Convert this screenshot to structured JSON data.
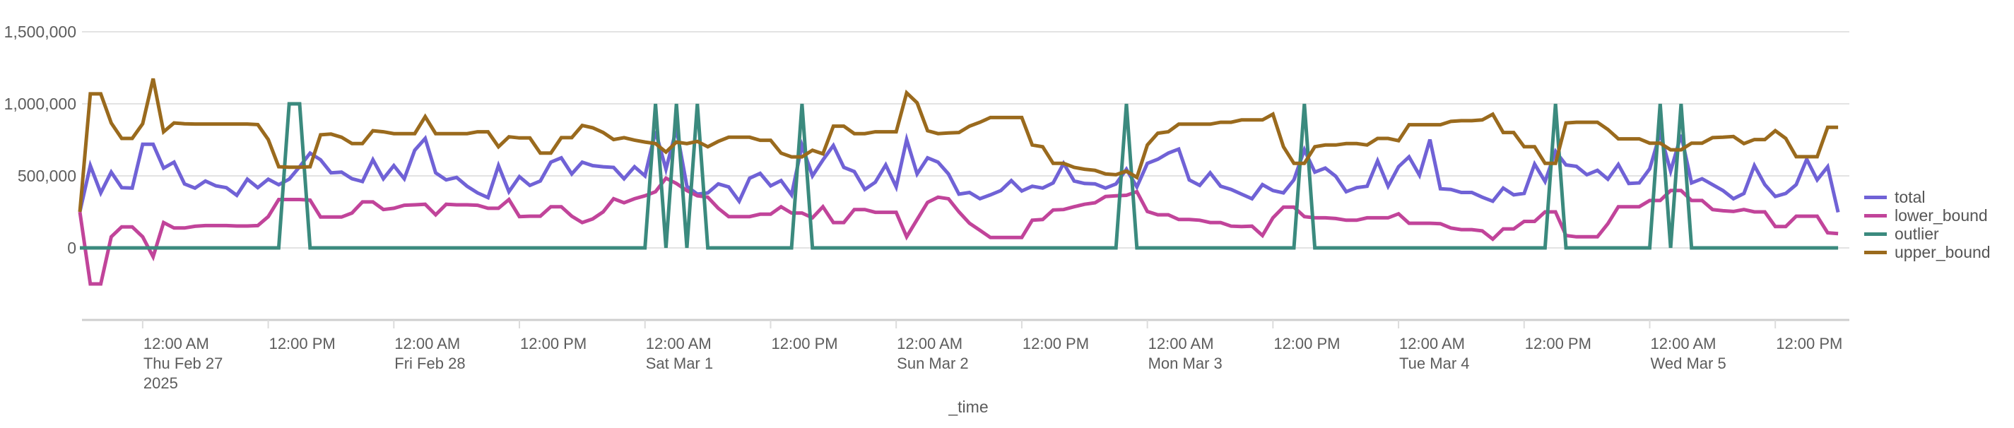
{
  "chart_data": {
    "type": "line",
    "title": "",
    "xlabel": "_time",
    "ylabel": "",
    "ylim": [
      -500000,
      1500000
    ],
    "yticks": [
      0,
      500000,
      1000000,
      1500000
    ],
    "ytick_labels": [
      "0",
      "500,000",
      "1,000,000",
      "1,500,000"
    ],
    "grid": true,
    "legend_position": "right",
    "x_start": "2025-02-26T18:00",
    "x_step_hours": 1,
    "x_axis_end_hours": 169,
    "xticks": [
      {
        "hours": 6,
        "lines": [
          "12:00 AM",
          "Thu Feb 27",
          "2025"
        ]
      },
      {
        "hours": 18,
        "lines": [
          "12:00 PM"
        ]
      },
      {
        "hours": 30,
        "lines": [
          "12:00 AM",
          "Fri Feb 28"
        ]
      },
      {
        "hours": 42,
        "lines": [
          "12:00 PM"
        ]
      },
      {
        "hours": 54,
        "lines": [
          "12:00 AM",
          "Sat Mar 1"
        ]
      },
      {
        "hours": 66,
        "lines": [
          "12:00 PM"
        ]
      },
      {
        "hours": 78,
        "lines": [
          "12:00 AM",
          "Sun Mar 2"
        ]
      },
      {
        "hours": 90,
        "lines": [
          "12:00 PM"
        ]
      },
      {
        "hours": 102,
        "lines": [
          "12:00 AM",
          "Mon Mar 3"
        ]
      },
      {
        "hours": 114,
        "lines": [
          "12:00 PM"
        ]
      },
      {
        "hours": 126,
        "lines": [
          "12:00 AM",
          "Tue Mar 4"
        ]
      },
      {
        "hours": 138,
        "lines": [
          "12:00 PM"
        ]
      },
      {
        "hours": 150,
        "lines": [
          "12:00 AM",
          "Wed Mar 5"
        ]
      },
      {
        "hours": 162,
        "lines": [
          "12:00 PM"
        ]
      }
    ],
    "series": [
      {
        "name": "total",
        "color": "#7062d6",
        "values": [
          250000,
          571000,
          382000,
          526000,
          418000,
          415000,
          719000,
          719000,
          554000,
          595000,
          444000,
          415000,
          464000,
          431000,
          418000,
          365000,
          477000,
          418000,
          477000,
          438000,
          477000,
          563000,
          658000,
          612000,
          521000,
          526000,
          480000,
          461000,
          612000,
          480000,
          571000,
          480000,
          678000,
          760000,
          521000,
          472000,
          489000,
          428000,
          382000,
          349000,
          571000,
          390000,
          494000,
          434000,
          464000,
          595000,
          625000,
          513000,
          595000,
          571000,
          563000,
          559000,
          480000,
          563000,
          500000,
          809000,
          546000,
          826000,
          428000,
          373000,
          382000,
          444000,
          423000,
          324000,
          484000,
          517000,
          431000,
          467000,
          368000,
          711000,
          500000,
          610000,
          711000,
          559000,
          530000,
          406000,
          456000,
          576000,
          423000,
          752000,
          513000,
          625000,
          595000,
          513000,
          373000,
          385000,
          341000,
          368000,
          398000,
          467000,
          395000,
          428000,
          415000,
          451000,
          587000,
          464000,
          447000,
          444000,
          415000,
          444000,
          546000,
          423000,
          587000,
          615000,
          658000,
          686000,
          472000,
          434000,
          521000,
          428000,
          406000,
          373000,
          341000,
          439000,
          398000,
          382000,
          472000,
          681000,
          526000,
          554000,
          497000,
          390000,
          418000,
          428000,
          604000,
          428000,
          563000,
          632000,
          505000,
          752000,
          411000,
          406000,
          385000,
          385000,
          352000,
          324000,
          415000,
          368000,
          378000,
          582000,
          461000,
          670000,
          576000,
          566000,
          508000,
          538000,
          477000,
          579000,
          447000,
          451000,
          549000,
          796000,
          533000,
          785000,
          451000,
          480000,
          439000,
          398000,
          341000,
          378000,
          571000,
          439000,
          357000,
          378000,
          439000,
          615000,
          472000,
          563000,
          247000
        ]
      },
      {
        "name": "lower_bound",
        "color": "#c1449a",
        "values": [
          250000,
          -250000,
          -250000,
          77000,
          146000,
          146000,
          77000,
          -62000,
          176000,
          138000,
          138000,
          150000,
          155000,
          155000,
          155000,
          152000,
          152000,
          155000,
          217000,
          336000,
          336000,
          336000,
          332000,
          214000,
          214000,
          214000,
          242000,
          319000,
          319000,
          266000,
          275000,
          296000,
          299000,
          303000,
          230000,
          303000,
          299000,
          299000,
          296000,
          275000,
          275000,
          336000,
          217000,
          220000,
          220000,
          286000,
          286000,
          220000,
          176000,
          201000,
          250000,
          341000,
          313000,
          341000,
          362000,
          390000,
          484000,
          447000,
          398000,
          362000,
          352000,
          275000,
          217000,
          217000,
          217000,
          234000,
          234000,
          286000,
          242000,
          242000,
          209000,
          286000,
          176000,
          176000,
          266000,
          266000,
          247000,
          247000,
          247000,
          77000,
          197000,
          316000,
          352000,
          341000,
          250000,
          171000,
          122000,
          72000,
          72000,
          72000,
          72000,
          192000,
          197000,
          263000,
          266000,
          286000,
          303000,
          313000,
          357000,
          362000,
          365000,
          390000,
          253000,
          230000,
          230000,
          197000,
          197000,
          192000,
          176000,
          176000,
          151000,
          148000,
          151000,
          86000,
          209000,
          283000,
          283000,
          217000,
          209000,
          209000,
          204000,
          192000,
          192000,
          209000,
          209000,
          209000,
          237000,
          171000,
          171000,
          171000,
          168000,
          138000,
          127000,
          127000,
          118000,
          61000,
          132000,
          132000,
          184000,
          184000,
          250000,
          250000,
          86000,
          77000,
          77000,
          77000,
          168000,
          286000,
          286000,
          286000,
          329000,
          329000,
          398000,
          398000,
          329000,
          329000,
          266000,
          258000,
          253000,
          266000,
          250000,
          250000,
          148000,
          148000,
          220000,
          220000,
          220000,
          105000,
          99000
        ]
      },
      {
        "name": "outlier",
        "color": "#3b8a7e",
        "values": [
          0,
          0,
          0,
          0,
          0,
          0,
          0,
          0,
          0,
          0,
          0,
          0,
          0,
          0,
          0,
          0,
          0,
          0,
          0,
          0,
          1000000,
          1000000,
          0,
          0,
          0,
          0,
          0,
          0,
          0,
          0,
          0,
          0,
          0,
          0,
          0,
          0,
          0,
          0,
          0,
          0,
          0,
          0,
          0,
          0,
          0,
          0,
          0,
          0,
          0,
          0,
          0,
          0,
          0,
          0,
          0,
          1000000,
          0,
          1000000,
          0,
          1000000,
          0,
          0,
          0,
          0,
          0,
          0,
          0,
          0,
          0,
          1000000,
          0,
          0,
          0,
          0,
          0,
          0,
          0,
          0,
          0,
          0,
          0,
          0,
          0,
          0,
          0,
          0,
          0,
          0,
          0,
          0,
          0,
          0,
          0,
          0,
          0,
          0,
          0,
          0,
          0,
          0,
          1000000,
          0,
          0,
          0,
          0,
          0,
          0,
          0,
          0,
          0,
          0,
          0,
          0,
          0,
          0,
          0,
          0,
          1000000,
          0,
          0,
          0,
          0,
          0,
          0,
          0,
          0,
          0,
          0,
          0,
          0,
          0,
          0,
          0,
          0,
          0,
          0,
          0,
          0,
          0,
          0,
          0,
          1000000,
          0,
          0,
          0,
          0,
          0,
          0,
          0,
          0,
          0,
          1000000,
          0,
          1000000,
          0,
          0,
          0,
          0,
          0,
          0,
          0,
          0,
          0,
          0,
          0,
          0,
          0,
          0,
          0
        ]
      },
      {
        "name": "upper_bound",
        "color": "#9a6a1d",
        "values": [
          250000,
          1069000,
          1069000,
          867000,
          760000,
          760000,
          862000,
          1175000,
          806000,
          867000,
          862000,
          860000,
          860000,
          860000,
          860000,
          860000,
          860000,
          856000,
          752000,
          563000,
          560000,
          560000,
          563000,
          785000,
          790000,
          768000,
          724000,
          724000,
          813000,
          806000,
          793000,
          793000,
          793000,
          911000,
          793000,
          793000,
          793000,
          793000,
          806000,
          806000,
          702000,
          771000,
          763000,
          763000,
          658000,
          658000,
          765000,
          765000,
          850000,
          834000,
          801000,
          752000,
          765000,
          748000,
          735000,
          724000,
          665000,
          735000,
          724000,
          739000,
          702000,
          739000,
          768000,
          768000,
          768000,
          747000,
          747000,
          658000,
          632000,
          632000,
          678000,
          653000,
          845000,
          845000,
          793000,
          793000,
          806000,
          806000,
          806000,
          1076000,
          1007000,
          813000,
          793000,
          798000,
          801000,
          845000,
          872000,
          905000,
          905000,
          905000,
          905000,
          714000,
          702000,
          587000,
          587000,
          559000,
          546000,
          538000,
          513000,
          508000,
          533000,
          489000,
          714000,
          796000,
          806000,
          859000,
          859000,
          859000,
          859000,
          872000,
          872000,
          888000,
          888000,
          888000,
          928000,
          702000,
          587000,
          587000,
          702000,
          714000,
          714000,
          724000,
          724000,
          714000,
          760000,
          760000,
          744000,
          855000,
          855000,
          855000,
          855000,
          878000,
          883000,
          883000,
          888000,
          928000,
          801000,
          801000,
          702000,
          702000,
          587000,
          587000,
          867000,
          872000,
          872000,
          872000,
          822000,
          757000,
          757000,
          757000,
          727000,
          727000,
          681000,
          681000,
          727000,
          727000,
          765000,
          768000,
          773000,
          724000,
          752000,
          752000,
          813000,
          760000,
          633000,
          633000,
          633000,
          837000,
          837000
        ]
      }
    ]
  },
  "legend": {
    "items": [
      {
        "label": "total",
        "color": "#7062d6"
      },
      {
        "label": "lower_bound",
        "color": "#c1449a"
      },
      {
        "label": "outlier",
        "color": "#3b8a7e"
      },
      {
        "label": "upper_bound",
        "color": "#9a6a1d"
      }
    ]
  }
}
